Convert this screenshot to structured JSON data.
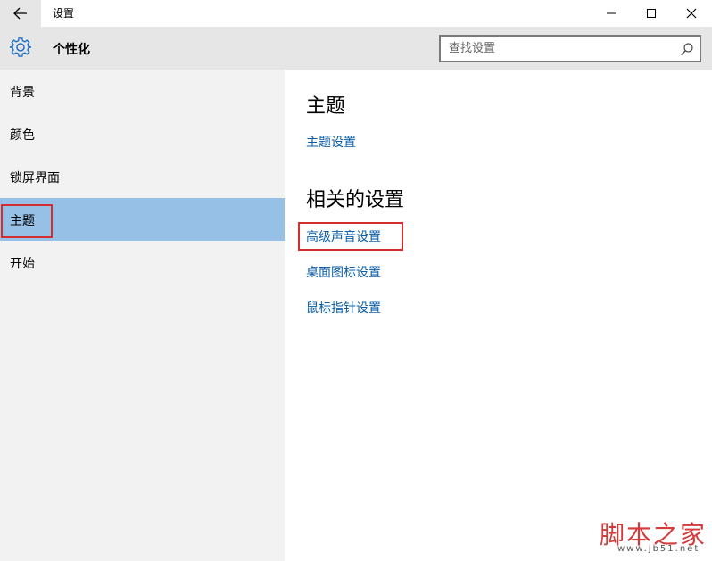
{
  "window": {
    "title": "设置",
    "controls": [
      "minimize-icon",
      "maximize-icon",
      "close-icon"
    ]
  },
  "header": {
    "icon": "gear-icon",
    "title": "个性化",
    "search": {
      "placeholder": "查找设置",
      "value": ""
    }
  },
  "sidebar": {
    "items": [
      {
        "label": "背景"
      },
      {
        "label": "颜色"
      },
      {
        "label": "锁屏界面"
      },
      {
        "label": "主题",
        "selected": true
      },
      {
        "label": "开始"
      }
    ],
    "selected_color": "#96c0e6"
  },
  "main": {
    "section1": {
      "heading": "主题",
      "links": [
        "主题设置"
      ]
    },
    "section2": {
      "heading": "相关的设置",
      "links": [
        "高级声音设置",
        "桌面图标设置",
        "鼠标指针设置"
      ]
    },
    "link_color": "#0b5ea8",
    "annotation_color": "#d32f2f"
  },
  "watermark": {
    "text": "脚本之家",
    "url": "www.jb51.net"
  }
}
